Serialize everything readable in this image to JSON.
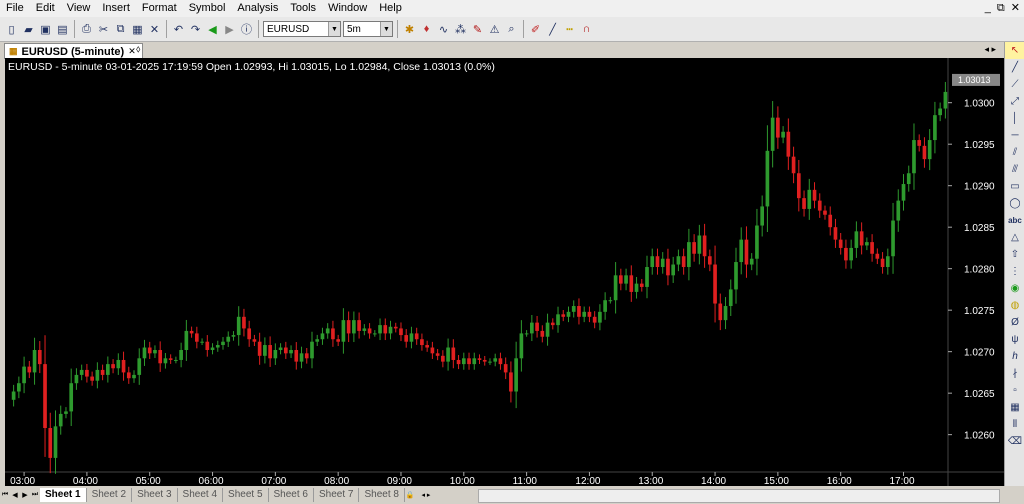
{
  "menu": [
    "File",
    "Edit",
    "View",
    "Insert",
    "Format",
    "Symbol",
    "Analysis",
    "Tools",
    "Window",
    "Help"
  ],
  "window_controls": [
    "_",
    "⧉",
    "✕"
  ],
  "toolbar": {
    "symbol": "EURUSD",
    "interval": "5m"
  },
  "tab": {
    "title": "EURUSD (5-minute)"
  },
  "chart": {
    "header": "EURUSD - 5-minute 03-01-2025 17:19:59 Open 1.02993, Hi 1.03015, Lo 1.02984, Close 1.03013 (0.0%)",
    "last_price_label": "1.03013"
  },
  "chart_data": {
    "type": "candlestick",
    "symbol": "EURUSD",
    "interval": "5-minute",
    "up_color": "#2e9a2e",
    "down_color": "#e02020",
    "background": "#000000",
    "x_ticks": [
      "03:00",
      "04:00",
      "05:00",
      "06:00",
      "07:00",
      "08:00",
      "09:00",
      "10:00",
      "11:00",
      "12:00",
      "13:00",
      "14:00",
      "15:00",
      "16:00",
      "17:00"
    ],
    "y_ticks": [
      "1.0300",
      "1.0295",
      "1.0290",
      "1.0285",
      "1.0280",
      "1.0275",
      "1.0270",
      "1.0265",
      "1.0260"
    ],
    "ylim": [
      1.02555,
      1.03037
    ],
    "close": [
      1.02652,
      1.02662,
      1.02682,
      1.02675,
      1.02702,
      1.02685,
      1.02608,
      1.02572,
      1.0261,
      1.02625,
      1.02628,
      1.02662,
      1.02672,
      1.02678,
      1.0267,
      1.02665,
      1.02678,
      1.02672,
      1.02685,
      1.0268,
      1.0269,
      1.02675,
      1.02668,
      1.02672,
      1.02692,
      1.02705,
      1.02698,
      1.02702,
      1.02686,
      1.02692,
      1.0269,
      1.0269,
      1.02702,
      1.02725,
      1.02722,
      1.02712,
      1.02712,
      1.02702,
      1.02705,
      1.02708,
      1.02712,
      1.02718,
      1.0272,
      1.02742,
      1.02728,
      1.02715,
      1.02712,
      1.02695,
      1.02708,
      1.02692,
      1.02702,
      1.02705,
      1.02698,
      1.02702,
      1.02688,
      1.02698,
      1.02692,
      1.02712,
      1.02715,
      1.02722,
      1.02728,
      1.02715,
      1.02712,
      1.02738,
      1.02722,
      1.02738,
      1.02725,
      1.02728,
      1.02722,
      1.02722,
      1.02732,
      1.02722,
      1.0273,
      1.02728,
      1.0272,
      1.02712,
      1.02722,
      1.02715,
      1.02708,
      1.02705,
      1.02698,
      1.02695,
      1.02688,
      1.02705,
      1.0269,
      1.02685,
      1.02692,
      1.02685,
      1.02692,
      1.0269,
      1.02688,
      1.02688,
      1.02692,
      1.02685,
      1.02675,
      1.02652,
      1.02692,
      1.02722,
      1.02722,
      1.02735,
      1.02725,
      1.02718,
      1.02735,
      1.02732,
      1.02745,
      1.02742,
      1.02748,
      1.02755,
      1.02742,
      1.02748,
      1.02742,
      1.02735,
      1.02748,
      1.02762,
      1.02762,
      1.02792,
      1.02782,
      1.02792,
      1.02772,
      1.02782,
      1.02778,
      1.02802,
      1.02815,
      1.02802,
      1.02812,
      1.02792,
      1.02805,
      1.02815,
      1.02802,
      1.02832,
      1.02818,
      1.0284,
      1.02815,
      1.02805,
      1.02758,
      1.02738,
      1.02755,
      1.02775,
      1.02808,
      1.02835,
      1.02805,
      1.02812,
      1.02852,
      1.02875,
      1.02942,
      1.02982,
      1.02958,
      1.02965,
      1.02935,
      1.02915,
      1.02885,
      1.02872,
      1.02895,
      1.02882,
      1.0287,
      1.02865,
      1.0285,
      1.02835,
      1.02825,
      1.0281,
      1.02825,
      1.02845,
      1.02828,
      1.02832,
      1.02818,
      1.02812,
      1.02802,
      1.02815,
      1.02858,
      1.02882,
      1.02902,
      1.02915,
      1.02955,
      1.02948,
      1.02932,
      1.02955,
      1.02985,
      1.02993,
      1.03013
    ]
  }
}
